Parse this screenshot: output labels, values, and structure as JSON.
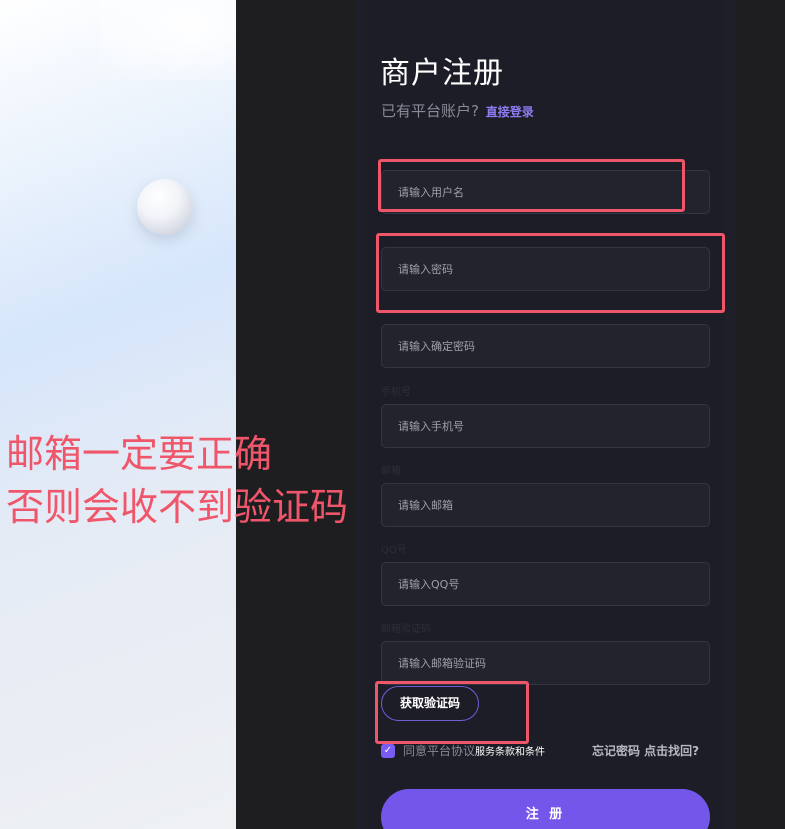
{
  "form": {
    "title": "商户注册",
    "subtitle_prefix": "已有平台账户?",
    "login_link": "直接登录",
    "fields": {
      "username": {
        "placeholder": "请输入用户名"
      },
      "password": {
        "placeholder": "请输入密码"
      },
      "confirm_password": {
        "placeholder": "请输入确定密码"
      },
      "phone": {
        "label": "手机号",
        "placeholder": "请输入手机号"
      },
      "email": {
        "label": "邮箱",
        "placeholder": "请输入邮箱"
      },
      "qq": {
        "label": "QQ号",
        "placeholder": "请输入QQ号"
      },
      "email_code": {
        "label": "邮箱验证码",
        "placeholder": "请输入邮箱验证码"
      }
    },
    "get_code_button": "获取验证码",
    "agree_text": "同意平台协议",
    "agree_terms": "服务条款和条件",
    "forgot_password": "忘记密码 点击找回?",
    "submit_button": "注 册"
  },
  "annotation": {
    "line1": "邮箱一定要正确",
    "line2": "否则会收不到验证码",
    "color": "#f0566a"
  },
  "colors": {
    "accent": "#7456ea",
    "panel_bg": "#1d1d27",
    "input_bg": "#23232e"
  }
}
